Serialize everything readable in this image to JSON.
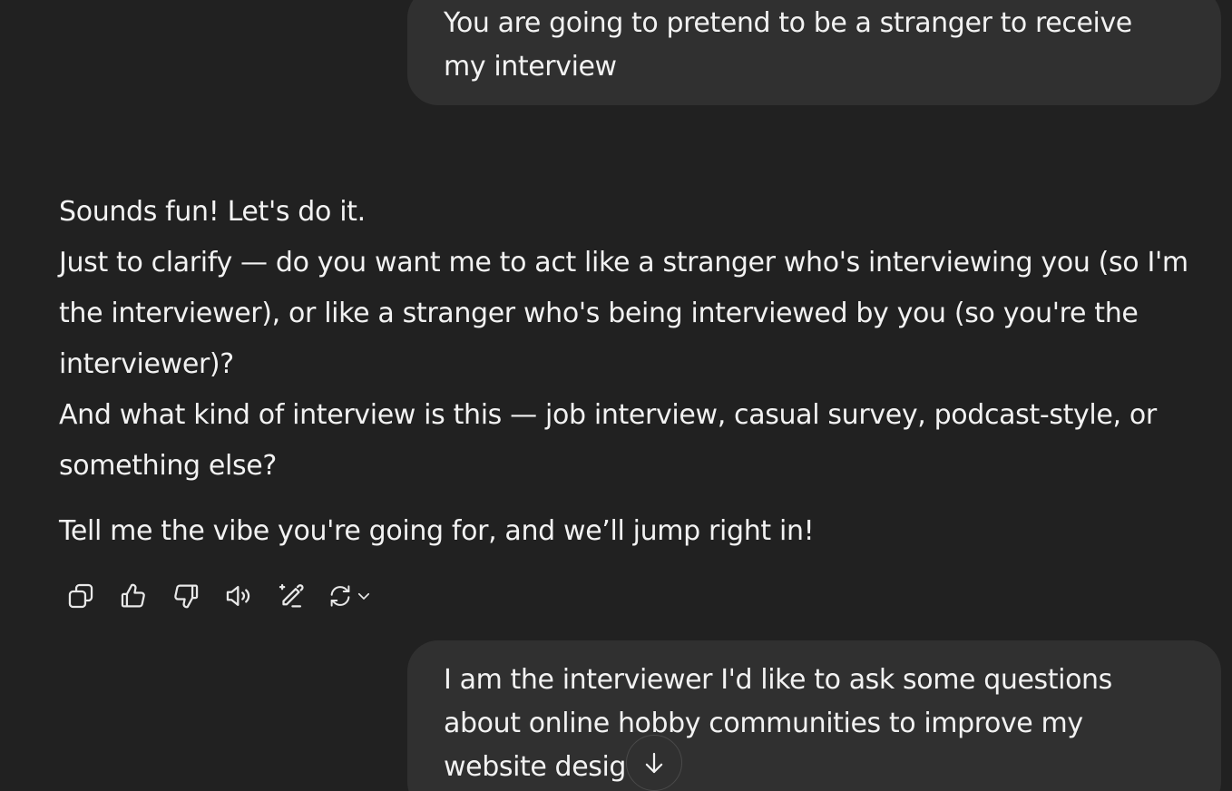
{
  "conversation": {
    "user_message_1": {
      "line1": "You are going to pretend to be a stranger to receive",
      "line2": "my interview"
    },
    "assistant_message": {
      "p1": "Sounds fun! Let's do it.",
      "p2": "Just to clarify — do you want me to act like a stranger who's interviewing you (so I'm the interviewer), or like a stranger who's being interviewed by you (so you're the interviewer)?",
      "p3": "And what kind of interview is this — job interview, casual survey, podcast-style, or something else?",
      "p4": "Tell me the vibe you're going for, and we’ll jump right in!"
    },
    "user_message_2": {
      "line1": "I am the interviewer I'd like to ask some questions",
      "line2": "about online hobby communities to improve my",
      "line3": "website desig"
    }
  },
  "actions": [
    {
      "icon": "copy-icon"
    },
    {
      "icon": "thumbs-up-icon"
    },
    {
      "icon": "thumbs-down-icon"
    },
    {
      "icon": "read-aloud-icon"
    },
    {
      "icon": "edit-icon"
    },
    {
      "icon": "regenerate-icon"
    }
  ],
  "scroll_button": {
    "icon": "arrow-down-icon"
  },
  "colors": {
    "background": "#212121",
    "bubble": "#303030",
    "text": "#f2f2f2"
  }
}
